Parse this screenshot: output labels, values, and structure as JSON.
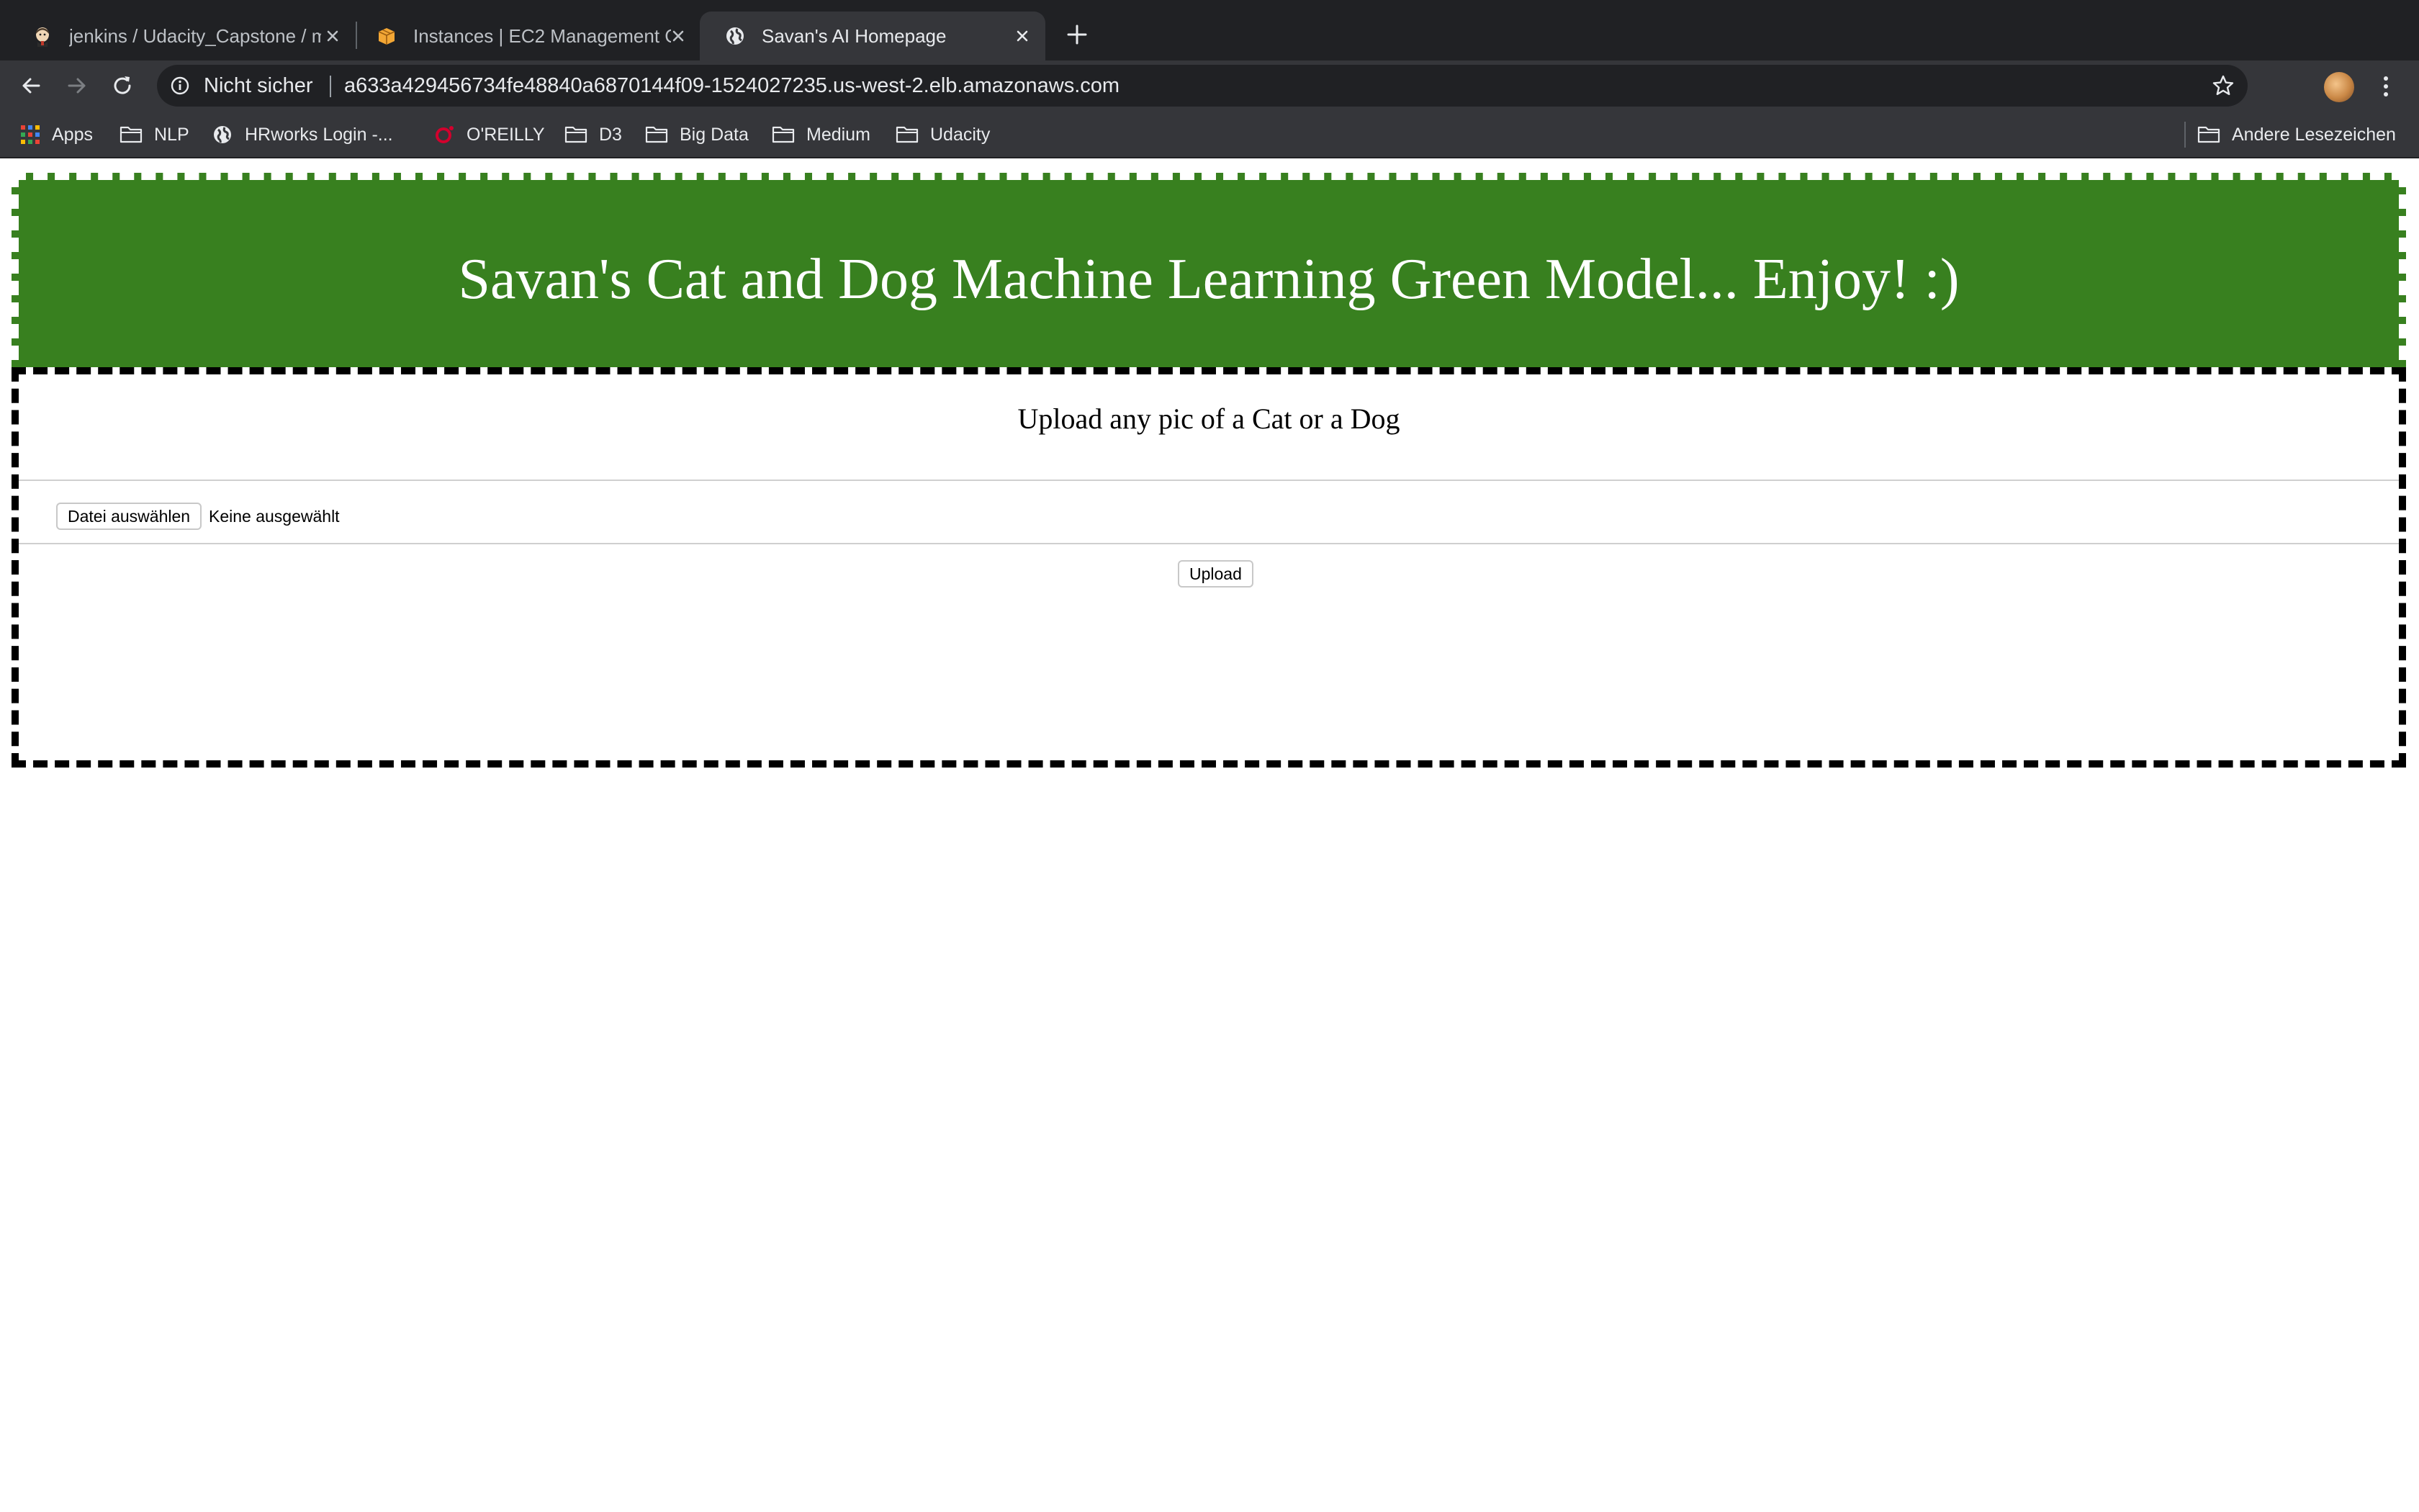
{
  "browser": {
    "tabs": [
      {
        "title": "jenkins / Udacity_Capstone / m",
        "favicon": "jenkins-icon",
        "active": false
      },
      {
        "title": "Instances | EC2 Management C",
        "favicon": "aws-box-icon",
        "active": false
      },
      {
        "title": "Savan's AI Homepage",
        "favicon": "globe-icon",
        "active": true
      }
    ],
    "omnibox": {
      "security_label": "Nicht sicher",
      "url": "a633a429456734fe48840a6870144f09-1524027235.us-west-2.elb.amazonaws.com"
    },
    "bookmarks": [
      {
        "label": "Apps",
        "icon": "apps-grid-icon"
      },
      {
        "label": "NLP",
        "icon": "folder-icon"
      },
      {
        "label": "HRworks Login -...",
        "icon": "globe-icon"
      },
      {
        "label": "O'REILLY",
        "icon": "oreilly-icon"
      },
      {
        "label": "D3",
        "icon": "folder-icon"
      },
      {
        "label": "Big Data",
        "icon": "folder-icon"
      },
      {
        "label": "Medium",
        "icon": "folder-icon"
      },
      {
        "label": "Udacity",
        "icon": "folder-icon"
      }
    ],
    "other_bookmarks": "Andere Lesezeichen"
  },
  "page": {
    "banner_title": "Savan's Cat and Dog Machine Learning Green Model... Enjoy! :)",
    "banner_color": "#38801f",
    "upload_heading": "Upload any pic of a Cat or a Dog",
    "file_button_label": "Datei auswählen",
    "file_status": "Keine ausgewählt",
    "upload_button_label": "Upload"
  }
}
